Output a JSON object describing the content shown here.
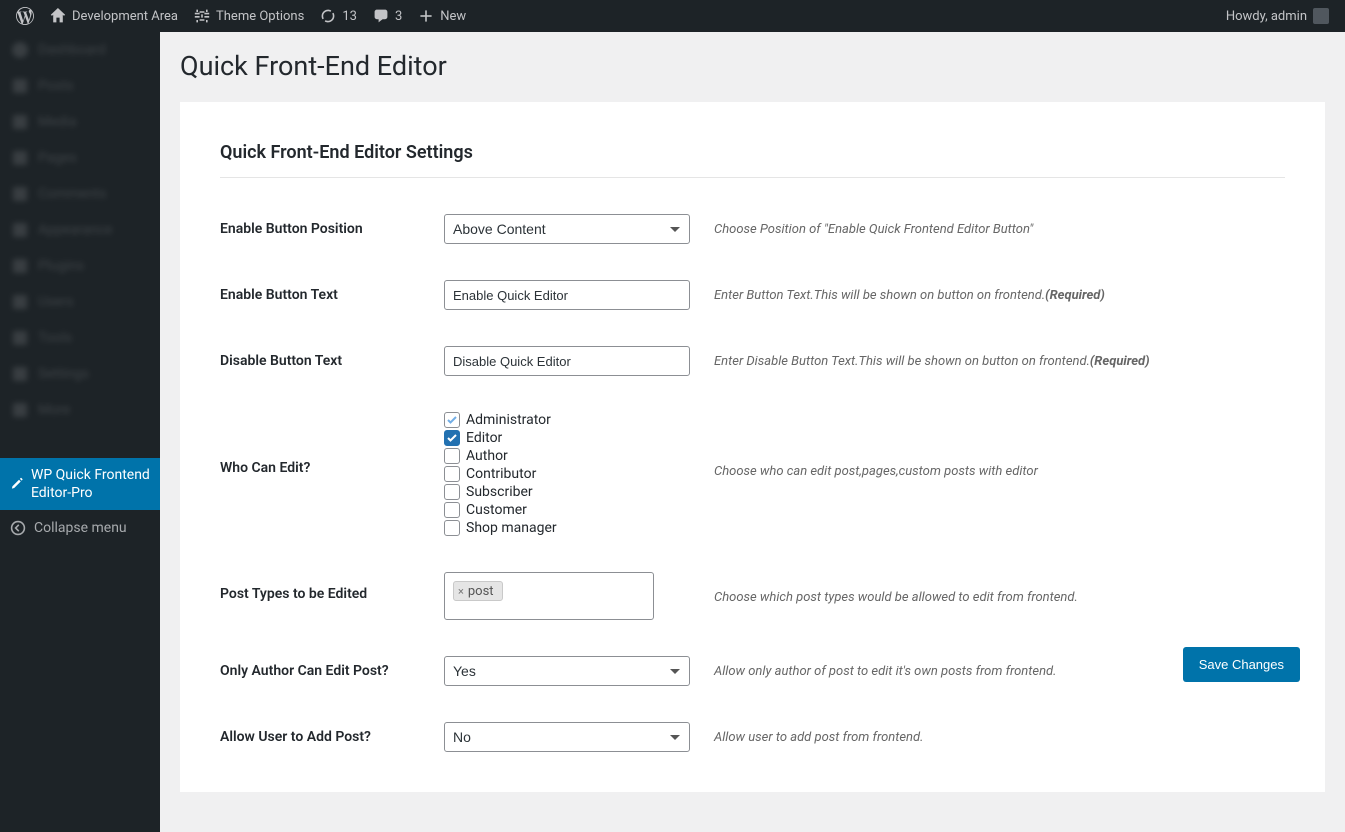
{
  "adminbar": {
    "site_name": "Development Area",
    "theme_options": "Theme Options",
    "updates_count": "13",
    "comments_count": "3",
    "new_label": "New",
    "greeting": "Howdy, admin"
  },
  "sidebar": {
    "dashboard": "Dashboard",
    "active_label": "WP Quick Frontend Editor-Pro",
    "collapse": "Collapse menu"
  },
  "page": {
    "title": "Quick Front-End Editor",
    "settings_title": "Quick Front-End Editor Settings"
  },
  "form": {
    "enable_position": {
      "label": "Enable Button Position",
      "value": "Above Content",
      "desc": "Choose Position of \"Enable Quick Frontend Editor Button\""
    },
    "enable_text": {
      "label": "Enable Button Text",
      "value": "Enable Quick Editor",
      "desc": "Enter Button Text.This will be shown on button on frontend.",
      "required": "(Required)"
    },
    "disable_text": {
      "label": "Disable Button Text",
      "value": "Disable Quick Editor",
      "desc": "Enter Disable Button Text.This will be shown on button on frontend.",
      "required": "(Required)"
    },
    "who_can_edit": {
      "label": "Who Can Edit?",
      "roles": {
        "administrator": "Administrator",
        "editor": "Editor",
        "author": "Author",
        "contributor": "Contributor",
        "subscriber": "Subscriber",
        "customer": "Customer",
        "shop_manager": "Shop manager"
      },
      "desc": "Choose who can edit post,pages,custom posts with editor"
    },
    "post_types": {
      "label": "Post Types to be Edited",
      "tag": "post",
      "desc": "Choose which post types would be allowed to edit from frontend."
    },
    "only_author": {
      "label": "Only Author Can Edit Post?",
      "value": "Yes",
      "desc": "Allow only author of post to edit it's own posts from frontend."
    },
    "allow_add": {
      "label": "Allow User to Add Post?",
      "value": "No",
      "desc": "Allow user to add post from frontend."
    },
    "save_button": "Save Changes"
  }
}
